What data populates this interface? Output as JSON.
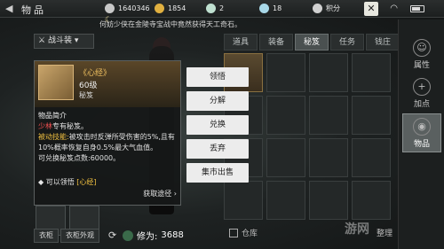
{
  "topbar": {
    "title": "物品",
    "silver": "1640346",
    "gold": "1854",
    "jade": "2",
    "gems": "18",
    "points": "积分"
  },
  "ticker": "何妨少侠在金陵寺宝战中竟然获得天工奇石。",
  "equip": {
    "mode": "战斗装",
    "wardrobe_btn": "衣柜",
    "wardrobe_look_btn": "衣柜外观",
    "power_label": "修为:",
    "power_value": "3688"
  },
  "tabs": [
    "道具",
    "装备",
    "秘笈",
    "任务",
    "钱庄"
  ],
  "active_tab_index": 2,
  "sidebar": [
    {
      "label": "属性",
      "icon": "person-icon"
    },
    {
      "label": "加点",
      "icon": "plus-icon"
    },
    {
      "label": "物品",
      "icon": "bag-icon"
    }
  ],
  "item": {
    "name": "《心经》",
    "level": "60级",
    "type": "秘笈",
    "intro_title": "物品简介",
    "line1_red": "少林",
    "line1_rest": "专有秘笈。",
    "passive_label": "被动技能:",
    "passive_text": "被攻击时反弹所受伤害的5%,且有10%概率恢复自身0.5%最大气血值。",
    "exchange_text": "可兑换秘笈点数:60000。",
    "tip_prefix": "可以领悟",
    "tip_link": "[心经]",
    "source_label": "获取途径"
  },
  "actions": [
    "领悟",
    "分解",
    "兑换",
    "丢弃",
    "集市出售"
  ],
  "bottom": {
    "warehouse": "仓库",
    "sort": "整理"
  },
  "watermark": "游网",
  "colors": {
    "accent_gold": "#f0c060",
    "red": "#f25050",
    "action_bg": "#ececec"
  }
}
